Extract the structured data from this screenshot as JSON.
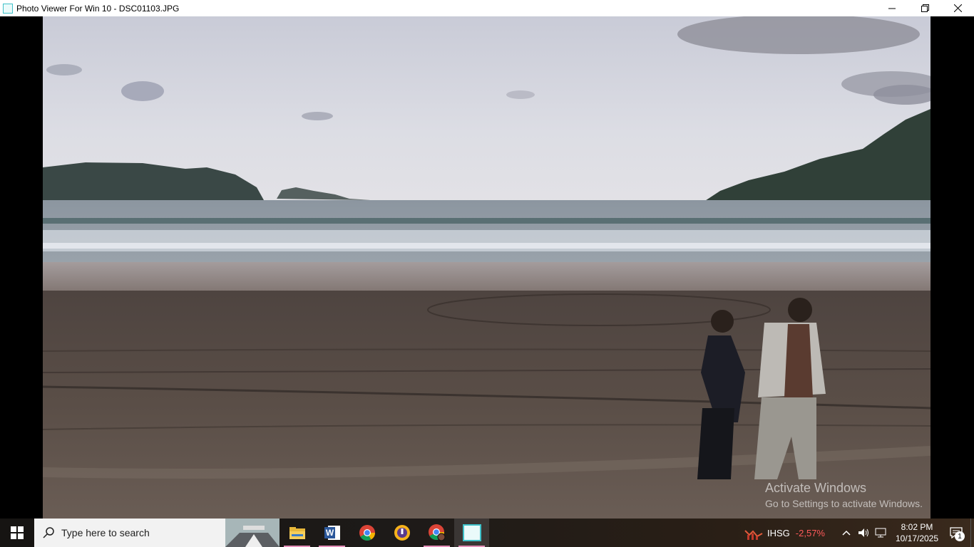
{
  "window": {
    "title": "Photo Viewer For Win 10 - DSC01103.JPG",
    "controls": {
      "minimize": "—",
      "maximize": "❐",
      "close": "✕"
    }
  },
  "watermark": {
    "title": "Activate Windows",
    "subtitle": "Go to Settings to activate Windows."
  },
  "taskbar": {
    "search_placeholder": "Type here to search",
    "apps": [
      {
        "icon": "file-explorer-icon"
      },
      {
        "icon": "word-icon",
        "letter": "W"
      },
      {
        "icon": "chrome-icon"
      },
      {
        "icon": "vpn-icon"
      },
      {
        "icon": "chrome-profile-icon"
      },
      {
        "icon": "photo-viewer-icon"
      }
    ],
    "ticker": {
      "name": "IHSG",
      "change": "-2,57%",
      "change_color": "#ff5a5a"
    },
    "clock": {
      "time": "8:02 PM",
      "date": "10/17/2025"
    },
    "notification_count": "1"
  }
}
